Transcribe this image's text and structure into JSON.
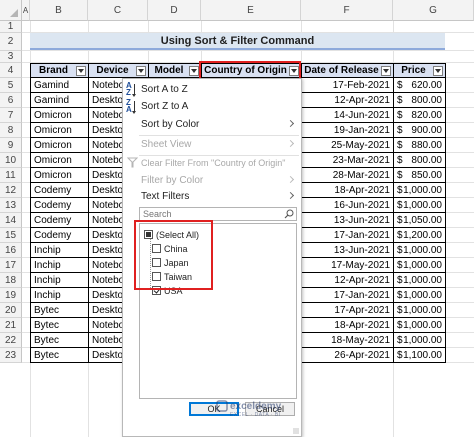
{
  "columns": [
    "A",
    "B",
    "C",
    "D",
    "E",
    "F",
    "G"
  ],
  "rows": [
    "1",
    "2",
    "3",
    "4",
    "5",
    "6",
    "7",
    "8",
    "9",
    "10",
    "11",
    "12",
    "13",
    "14",
    "15",
    "16",
    "17",
    "18",
    "19",
    "20",
    "21",
    "22",
    "23"
  ],
  "title": "Using Sort & Filter Command",
  "headers": {
    "brand": "Brand",
    "device": "Device",
    "model": "Model",
    "country": "Country of Origin",
    "date": "Date of Release",
    "price": "Price"
  },
  "table": [
    {
      "brand": "Gamind",
      "device": "Notebo",
      "date": "17-Feb-2021",
      "price": "620.00"
    },
    {
      "brand": "Gamind",
      "device": "Deskto",
      "date": "12-Apr-2021",
      "price": "800.00"
    },
    {
      "brand": "Omicron",
      "device": "Notebo",
      "date": "14-Jun-2021",
      "price": "820.00"
    },
    {
      "brand": "Omicron",
      "device": "Deskto",
      "date": "19-Jan-2021",
      "price": "900.00"
    },
    {
      "brand": "Omicron",
      "device": "Notebo",
      "date": "25-May-2021",
      "price": "880.00"
    },
    {
      "brand": "Omicron",
      "device": "Notebo",
      "date": "23-Mar-2021",
      "price": "800.00"
    },
    {
      "brand": "Omicron",
      "device": "Deskto",
      "date": "28-Mar-2021",
      "price": "850.00"
    },
    {
      "brand": "Codemy",
      "device": "Deskto",
      "date": "18-Apr-2021",
      "price": "1,000.00"
    },
    {
      "brand": "Codemy",
      "device": "Notebo",
      "date": "16-Jun-2021",
      "price": "1,000.00"
    },
    {
      "brand": "Codemy",
      "device": "Notebo",
      "date": "13-Jun-2021",
      "price": "1,050.00"
    },
    {
      "brand": "Codemy",
      "device": "Deskto",
      "date": "17-Jan-2021",
      "price": "1,200.00"
    },
    {
      "brand": "Inchip",
      "device": "Deskto",
      "date": "13-Jun-2021",
      "price": "1,000.00"
    },
    {
      "brand": "Inchip",
      "device": "Notebo",
      "date": "17-May-2021",
      "price": "1,000.00"
    },
    {
      "brand": "Inchip",
      "device": "Notebo",
      "date": "12-Apr-2021",
      "price": "1,000.00"
    },
    {
      "brand": "Inchip",
      "device": "Deskto",
      "date": "17-Jan-2021",
      "price": "1,000.00"
    },
    {
      "brand": "Bytec",
      "device": "Deskto",
      "date": "17-Apr-2021",
      "price": "1,000.00"
    },
    {
      "brand": "Bytec",
      "device": "Notebo",
      "date": "18-Apr-2021",
      "price": "1,000.00"
    },
    {
      "brand": "Bytec",
      "device": "Notebo",
      "date": "18-May-2021",
      "price": "1,000.00"
    },
    {
      "brand": "Bytec",
      "device": "Deskto",
      "date": "26-Apr-2021",
      "price": "1,100.00"
    }
  ],
  "currency": "$",
  "menu": {
    "sort_az": "Sort A to Z",
    "sort_za": "Sort Z to A",
    "sort_by_color": "Sort by Color",
    "sheet_view": "Sheet View",
    "clear_filter": "Clear Filter From \"Country of Origin\"",
    "filter_by_color": "Filter by Color",
    "text_filters": "Text Filters",
    "search_placeholder": "Search",
    "select_all": "(Select All)",
    "options": [
      "China",
      "Japan",
      "Taiwan",
      "USA"
    ],
    "ok": "OK",
    "cancel": "Cancel"
  },
  "watermark": {
    "name": "exceldemy",
    "tagline": "EXCEL · DATA · BI"
  },
  "colors": {
    "highlight": "#e02020",
    "header_fill": "#d9e1f2",
    "title_fill": "#dce6f1"
  }
}
